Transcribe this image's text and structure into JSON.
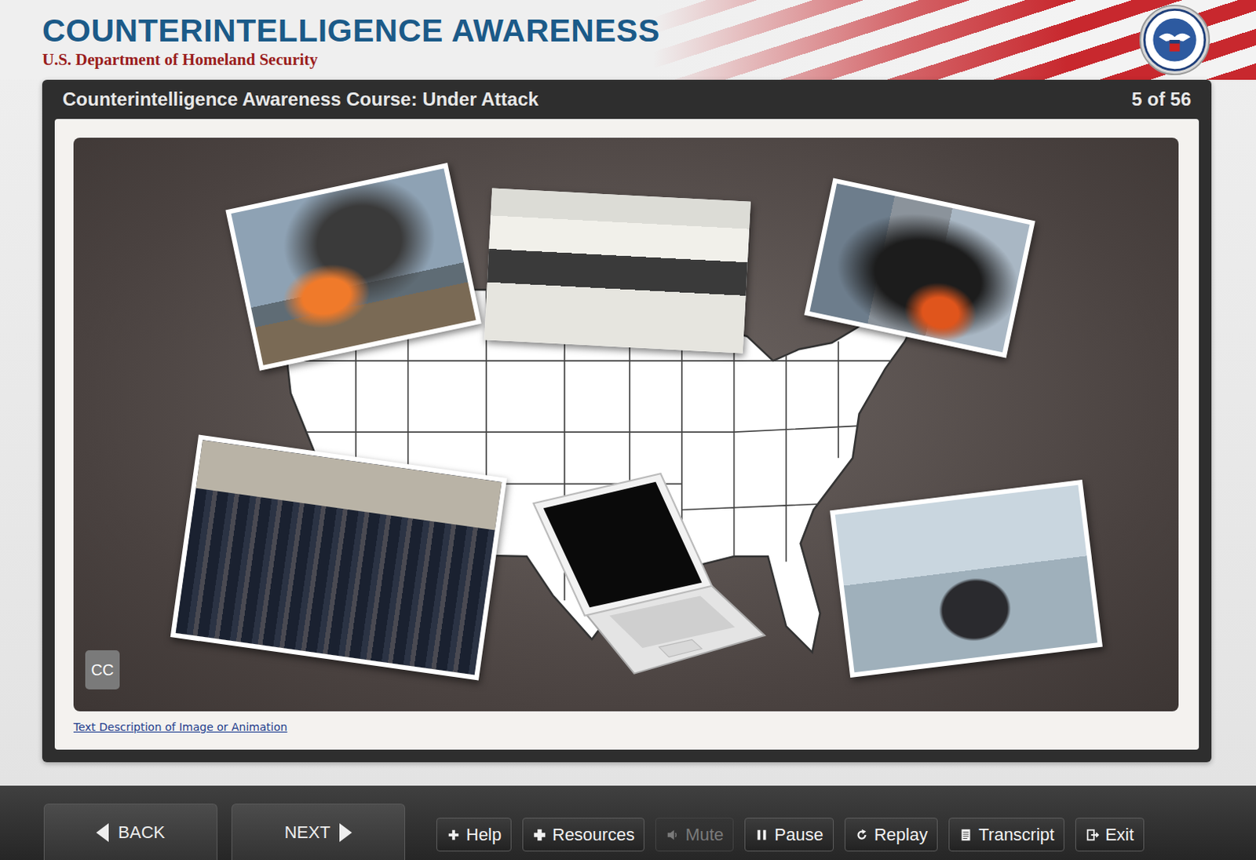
{
  "header": {
    "title": "COUNTERINTELLIGENCE AWARENESS",
    "subtitle": "U.S. Department of Homeland Security"
  },
  "course": {
    "title": "Counterintelligence Awareness Course: Under Attack",
    "page": "5 of 56"
  },
  "stage": {
    "cc": "CC"
  },
  "link": "Text Description of Image or Animation",
  "nav": [
    {
      "label": "BACK",
      "disabled": false
    },
    {
      "label": "NEXT",
      "disabled": false
    }
  ],
  "controls": [
    {
      "label": "Help",
      "disabled": false
    },
    {
      "label": "Resources",
      "disabled": false
    },
    {
      "label": "Mute",
      "disabled": true
    },
    {
      "label": "Pause",
      "disabled": false
    },
    {
      "label": "Replay",
      "disabled": false
    },
    {
      "label": "Transcript",
      "disabled": false
    },
    {
      "label": "Exit",
      "disabled": false
    }
  ]
}
